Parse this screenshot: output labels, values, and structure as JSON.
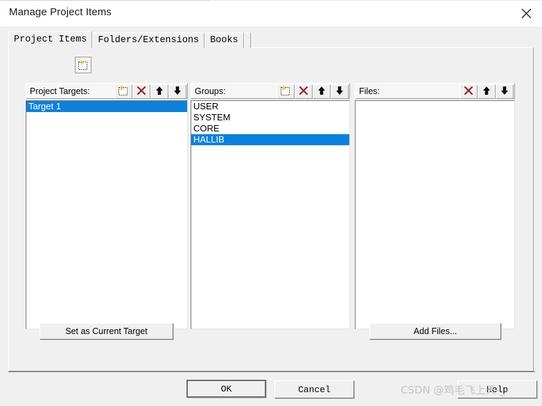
{
  "window": {
    "title": "Manage Project Items",
    "close_icon": "close-icon"
  },
  "tabs": [
    {
      "label": "Project Items",
      "active": true
    },
    {
      "label": "Folders/Extensions",
      "active": false
    },
    {
      "label": "Books",
      "active": false
    }
  ],
  "cursor_overlay": {
    "icon": "new-item-icon"
  },
  "panels": {
    "targets": {
      "label": "Project Targets:",
      "tools": [
        {
          "icon": "new-item-icon"
        },
        {
          "icon": "delete-icon"
        },
        {
          "icon": "move-up-icon"
        },
        {
          "icon": "move-down-icon"
        }
      ],
      "items": [
        {
          "label": "Target 1",
          "selected": true
        }
      ]
    },
    "groups": {
      "label": "Groups:",
      "tools": [
        {
          "icon": "new-item-icon"
        },
        {
          "icon": "delete-icon"
        },
        {
          "icon": "move-up-icon"
        },
        {
          "icon": "move-down-icon"
        }
      ],
      "items": [
        {
          "label": "USER",
          "selected": false
        },
        {
          "label": "SYSTEM",
          "selected": false
        },
        {
          "label": "CORE",
          "selected": false
        },
        {
          "label": "HALLIB",
          "selected": true
        }
      ]
    },
    "files": {
      "label": "Files:",
      "tools": [
        {
          "icon": "delete-icon"
        },
        {
          "icon": "move-up-icon"
        },
        {
          "icon": "move-down-icon"
        }
      ],
      "items": []
    }
  },
  "actions": {
    "set_current_target": "Set as Current Target",
    "add_files": "Add Files..."
  },
  "footer": {
    "ok": "OK",
    "cancel": "Cancel",
    "help": "Help"
  },
  "watermark": {
    "text": "CSDN @鸡毛飞上天-_-"
  },
  "colors": {
    "selection_blue": "#0a81df",
    "dialog_face": "#f0f0f0",
    "delete_red": "#a81818",
    "sparkle_yellow": "#ffe400"
  }
}
